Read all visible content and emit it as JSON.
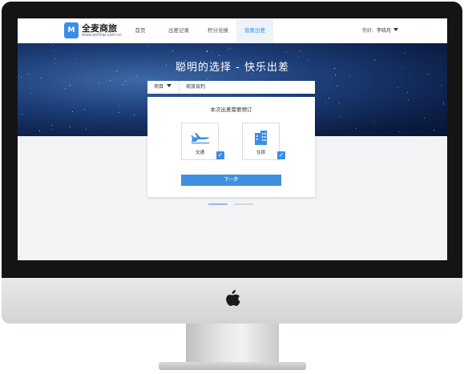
{
  "brand": {
    "name": "全麦商旅",
    "url": "www.qmtrip.com.cn",
    "logo_mark": "M"
  },
  "nav": {
    "items": [
      {
        "label": "首页"
      },
      {
        "label": "出差记录"
      },
      {
        "label": "积分兑换"
      },
      {
        "label": "我要出差",
        "active": true
      }
    ]
  },
  "user": {
    "greeting": "你好,",
    "name": "李晓月"
  },
  "hero": {
    "slogan": "聪明的选择 - 快乐出差"
  },
  "search": {
    "project_label": "项目",
    "project_value": "商旅谈判"
  },
  "panel": {
    "title": "本次出差需要预订",
    "options": [
      {
        "label": "交通",
        "icon": "plane-icon",
        "checked": true
      },
      {
        "label": "住宿",
        "icon": "building-icon",
        "checked": true
      }
    ],
    "next_label": "下一步"
  },
  "pager": {
    "count": 2,
    "active_index": 0
  },
  "colors": {
    "accent": "#3a8ee6",
    "hero": "#1d3e78",
    "bezel": "#141414"
  }
}
